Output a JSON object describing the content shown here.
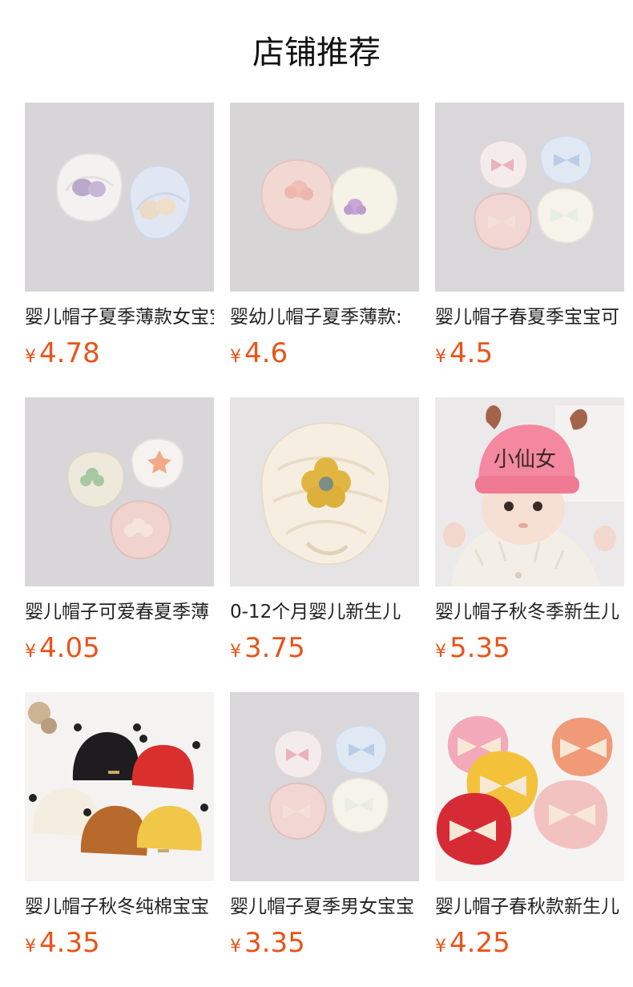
{
  "header": {
    "title": "店铺推荐"
  },
  "currency": "¥",
  "products": [
    {
      "name": "婴儿帽子夏季薄款女宝宝",
      "price": "4.78",
      "image": "two-lace-turbans-pastel",
      "colors": [
        "#f3f1f0",
        "#dfe6f3"
      ],
      "accent": [
        "#b9a6c8",
        "#e8d2c0"
      ]
    },
    {
      "name": "婴幼儿帽子夏季薄款:",
      "price": "4.6",
      "image": "two-turbans-pink-cream",
      "colors": [
        "#f2d6d0",
        "#f4f1e6"
      ],
      "accent": [
        "#f0c4bb",
        "#c7a6d6"
      ]
    },
    {
      "name": "婴儿帽子春夏季宝宝可",
      "price": "4.5",
      "image": "four-bow-turbans",
      "colors": [
        "#f3eaea",
        "#dee6f3",
        "#f1d4d2",
        "#f4f2ea"
      ],
      "accent": [
        "#eab3b8",
        "#b9cde6",
        "#f2dcd2",
        "#e9efe0"
      ]
    },
    {
      "name": "婴儿帽子可爱春夏季薄",
      "price": "4.05",
      "image": "three-flower-turbans",
      "colors": [
        "#f0eade",
        "#f4f1ee",
        "#f0d2cc"
      ],
      "accent": [
        "#a7c7a3",
        "#f2a78a",
        "#f4e0d8"
      ]
    },
    {
      "name": "0-12个月婴儿新生儿",
      "price": "3.75",
      "image": "cream-turban-yellow-flower",
      "colors": [
        "#f6eedf"
      ],
      "accent": [
        "#e1b640"
      ]
    },
    {
      "name": "婴儿帽子秋冬季新生儿",
      "price": "5.35",
      "image": "baby-pink-hat",
      "hat_text": "小仙女",
      "colors": [
        "#f38aa1"
      ],
      "accent": [
        "#a4644a"
      ]
    },
    {
      "name": "婴儿帽子秋冬纯棉宝宝",
      "price": "4.35",
      "image": "five-beanies",
      "colors": [
        "#1e1c1e",
        "#dc2c2c",
        "#f4eee0",
        "#b86a2c",
        "#f1c74a"
      ],
      "accent": [
        "#222222"
      ]
    },
    {
      "name": "婴儿帽子夏季男女宝宝",
      "price": "3.35",
      "image": "four-bow-turbans-b",
      "colors": [
        "#f3eaea",
        "#dee6f3",
        "#f1d4d2",
        "#f4f2ea"
      ],
      "accent": [
        "#eab3b8",
        "#b9cde6",
        "#f2dcd2",
        "#e9efe0"
      ]
    },
    {
      "name": "婴儿帽子春秋款新生儿",
      "price": "4.25",
      "image": "five-velvet-bow-turbans",
      "colors": [
        "#f3a9b9",
        "#f3c23a",
        "#f09a78",
        "#d62b35",
        "#f2c2c0"
      ],
      "accent": [
        "#f7e8d6"
      ]
    }
  ]
}
